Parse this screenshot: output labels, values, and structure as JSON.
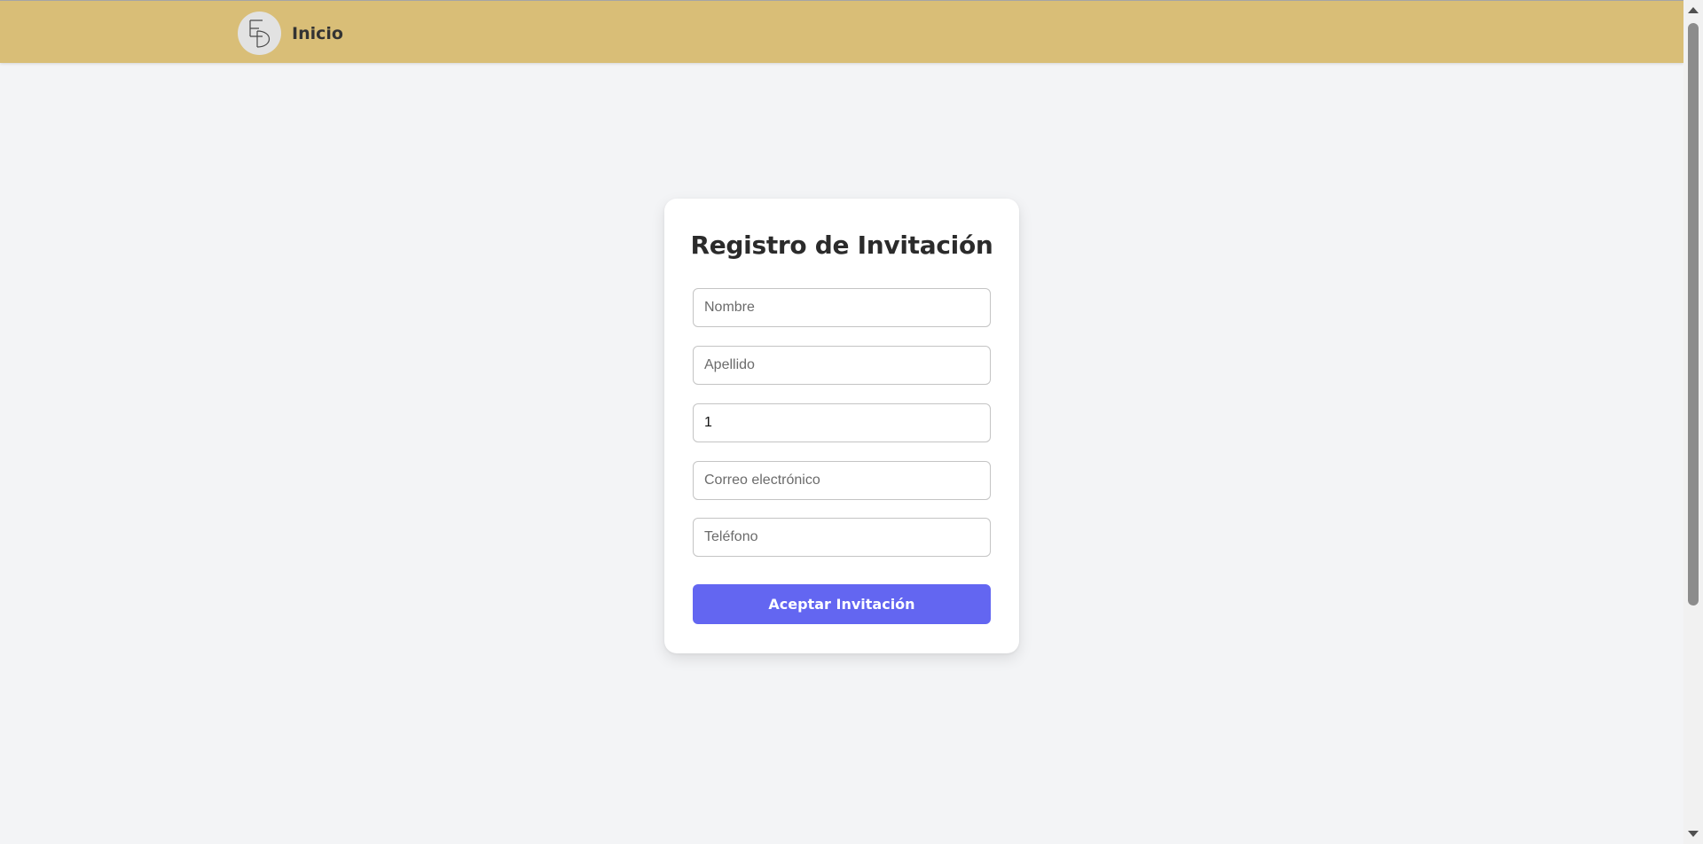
{
  "header": {
    "brand_label": "Inicio",
    "logo_icon": "monogram-logo-icon",
    "background_color": "#d9be77"
  },
  "form": {
    "title": "Registro de Invitación",
    "fields": {
      "nombre": {
        "placeholder": "Nombre",
        "value": ""
      },
      "apellido": {
        "placeholder": "Apellido",
        "value": ""
      },
      "cantidad": {
        "placeholder": "",
        "value": "1"
      },
      "correo": {
        "placeholder": "Correo electrónico",
        "value": ""
      },
      "telefono": {
        "placeholder": "Teléfono",
        "value": ""
      }
    },
    "submit_label": "Aceptar Invitación",
    "submit_color": "#6366f1"
  }
}
